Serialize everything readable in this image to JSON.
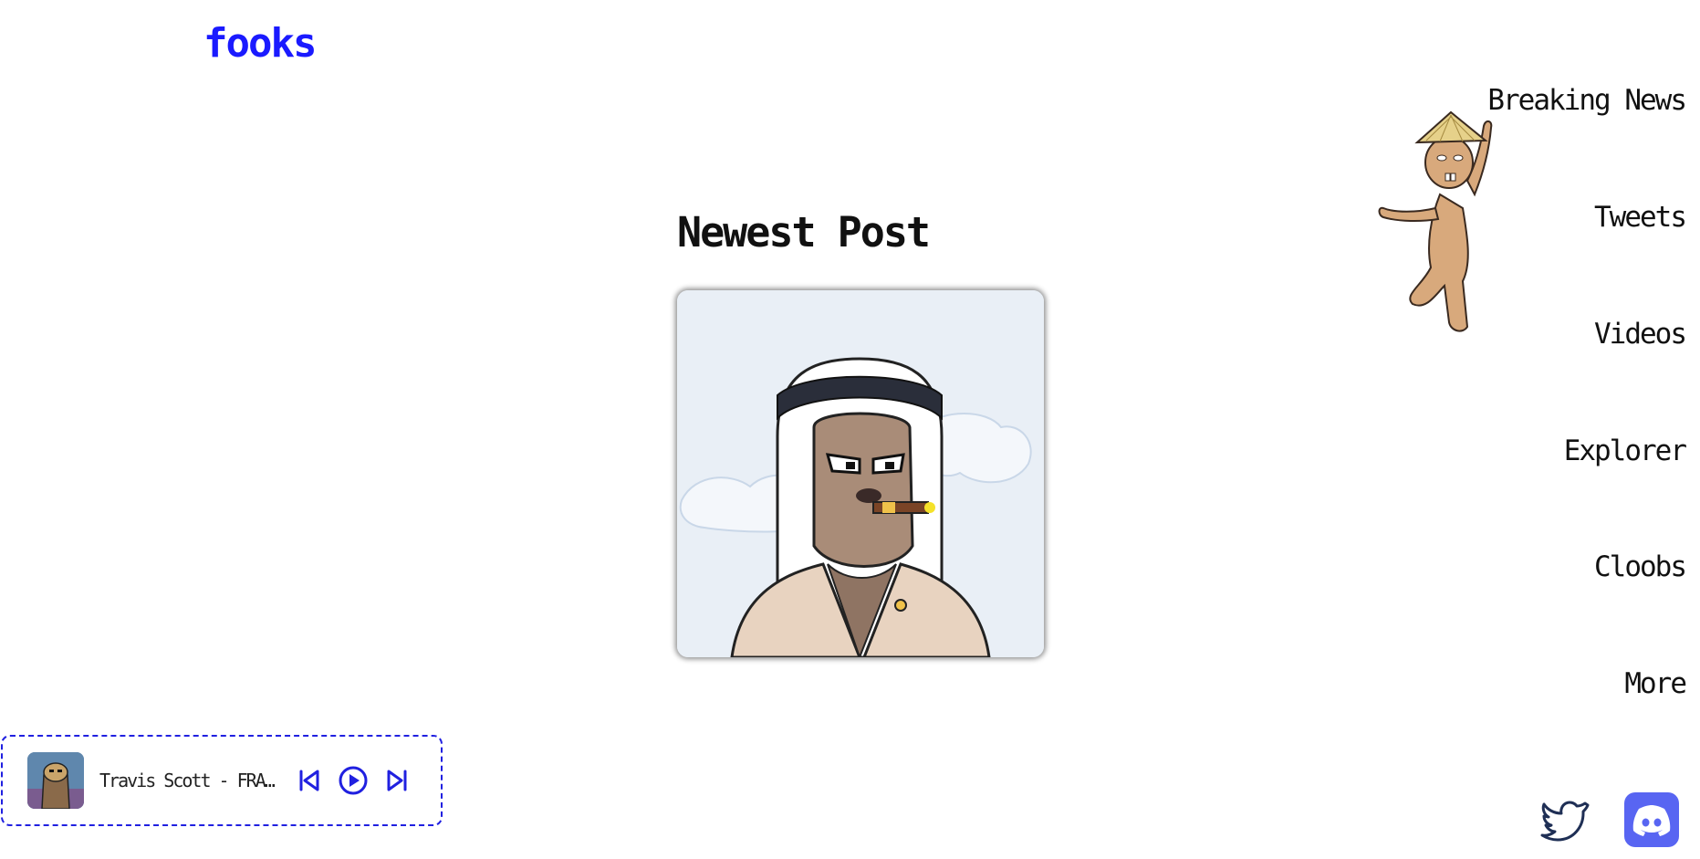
{
  "site": {
    "logo": "fooks"
  },
  "nav": {
    "items": [
      {
        "label": "Breaking News"
      },
      {
        "label": "Tweets"
      },
      {
        "label": "Videos"
      },
      {
        "label": "Explorer"
      },
      {
        "label": "Cloobs"
      },
      {
        "label": "More"
      }
    ]
  },
  "main": {
    "section_title": "Newest Post"
  },
  "player": {
    "track_title": "Travis Scott - FRANCHISE",
    "controls": [
      "skip-back-icon",
      "play-icon",
      "skip-forward-icon"
    ]
  },
  "social": {
    "icons": [
      "twitter-icon",
      "discord-icon"
    ]
  },
  "colors": {
    "brand_blue": "#1a1aff",
    "player_border": "#2020e0",
    "discord": "#5865f2",
    "twitter_outline": "#1f2f55",
    "post_background": "#e9eff6"
  }
}
